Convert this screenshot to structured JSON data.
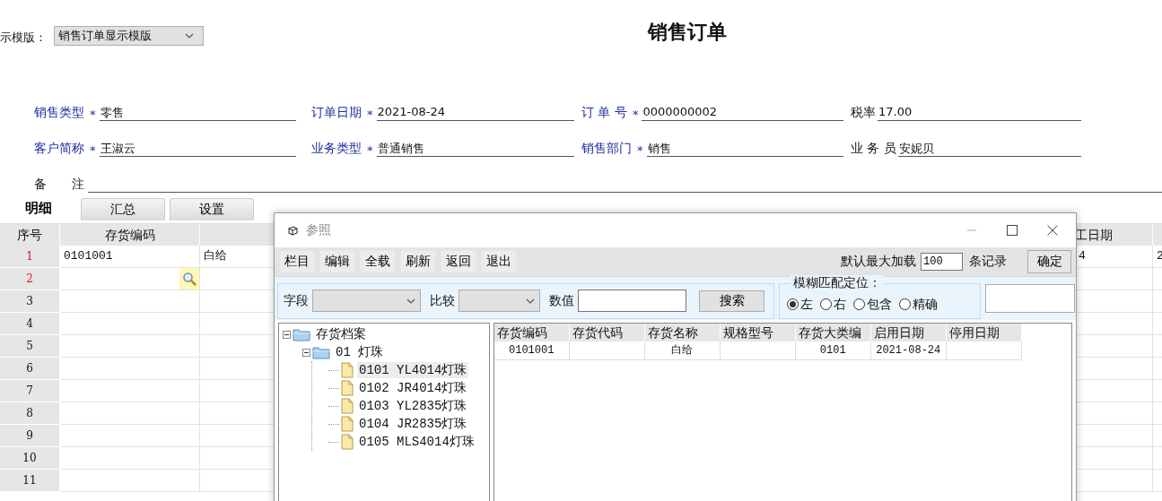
{
  "template": {
    "label": "示模版：",
    "value": "销售订单显示模版"
  },
  "title": "销售订单",
  "header_fields": [
    {
      "label": "销售类型",
      "required": true,
      "mark": "*",
      "value": "零售"
    },
    {
      "label": "订单日期",
      "required": true,
      "mark": "*",
      "value": "2021-08-24"
    },
    {
      "label": "订 单 号",
      "required": true,
      "mark": "*",
      "value": "0000000002"
    },
    {
      "label": "税率",
      "required": false,
      "value": "17.00"
    },
    {
      "label": "客户简称",
      "required": true,
      "mark": "*",
      "value": "王淑云"
    },
    {
      "label": "业务类型",
      "required": true,
      "mark": "*",
      "value": "普通销售"
    },
    {
      "label": "销售部门",
      "required": true,
      "mark": "*",
      "value": "销售"
    },
    {
      "label": "业 务 员",
      "required": false,
      "value": "安妮贝"
    }
  ],
  "remark": {
    "label": "备　　注"
  },
  "tabs": [
    {
      "label": "明细",
      "selected": true
    },
    {
      "label": "汇总",
      "selected": false
    },
    {
      "label": "设置",
      "selected": false
    }
  ],
  "table": {
    "columns": [
      {
        "kind": "labeled",
        "header": "序号"
      },
      {
        "kind": "labeled",
        "header": "存货编码"
      },
      {
        "kind": "unlabeled"
      },
      {
        "kind": "labeled",
        "header": "工日期"
      },
      {
        "kind": "unlabeled"
      }
    ],
    "rows": [
      {
        "number": "1",
        "edited": true,
        "lookup": false,
        "cells": [
          "0101001",
          "白给",
          "4",
          "2"
        ]
      },
      {
        "number": "2",
        "edited": true,
        "lookup": true
      },
      {
        "number": "3",
        "edited": false,
        "lookup": false
      },
      {
        "number": "4",
        "edited": false,
        "lookup": false
      },
      {
        "number": "5",
        "edited": false,
        "lookup": false
      },
      {
        "number": "6",
        "edited": false,
        "lookup": false
      },
      {
        "number": "7",
        "edited": false,
        "lookup": false
      },
      {
        "number": "8",
        "edited": false,
        "lookup": false
      },
      {
        "number": "9",
        "edited": false,
        "lookup": false
      },
      {
        "number": "10",
        "edited": false,
        "lookup": false
      },
      {
        "number": "11",
        "edited": false,
        "lookup": false
      }
    ]
  },
  "dialog": {
    "title": "参照",
    "toolbar": [
      "栏目",
      "编辑",
      "全载",
      "刷新",
      "返回",
      "退出"
    ],
    "max_load": {
      "label": "默认最大加载",
      "value": "100",
      "unit": "条记录"
    },
    "confirm": "确定",
    "filter": {
      "field_label": "字段",
      "compare_label": "比较",
      "value_label": "数值",
      "search": "搜索"
    },
    "fuzzy": {
      "legend": "模糊匹配定位：",
      "options": [
        {
          "label": "左",
          "selected": true
        },
        {
          "label": "右",
          "selected": false
        },
        {
          "label": "包含",
          "selected": false
        },
        {
          "label": "精确",
          "selected": false
        }
      ]
    },
    "tree": [
      {
        "label": "存货档案",
        "expanded": true,
        "selected": false,
        "children": [
          {
            "label": "01 灯珠",
            "expanded": true,
            "selected": false,
            "children": [
              {
                "label": "0101 YL4014灯珠",
                "selected": true
              },
              {
                "label": "0102 JR4014灯珠",
                "selected": false
              },
              {
                "label": "0103 YL2835灯珠",
                "selected": false
              },
              {
                "label": "0104 JR2835灯珠",
                "selected": false
              },
              {
                "label": "0105 MLS4014灯珠",
                "selected": false
              }
            ]
          }
        ]
      }
    ],
    "grid": {
      "columns": [
        "存货编码",
        "存货代码",
        "存货名称",
        "规格型号",
        "存货大类编",
        "启用日期",
        "停用日期"
      ],
      "rows": [
        [
          "0101001",
          null,
          "白给",
          null,
          "0101",
          "2021-08-24",
          null
        ]
      ]
    }
  }
}
